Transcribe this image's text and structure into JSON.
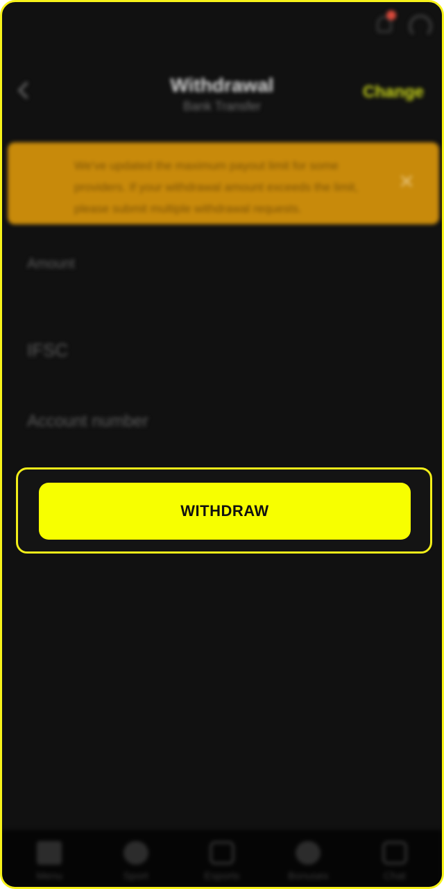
{
  "header": {
    "title": "Withdrawal",
    "subtitle": "Bank Transfer",
    "change_label": "Change"
  },
  "notice": {
    "text": "We've updated the maximum payout limit for some providers. If your withdrawal amount exceeds the limit, please submit multiple withdrawal requests.",
    "close_symbol": "✕"
  },
  "form": {
    "amount_label": "Amount",
    "ifsc_label": "IFSC",
    "account_label": "Account number"
  },
  "withdraw_button": {
    "label": "WITHDRAW"
  },
  "bottom_nav": {
    "items": [
      {
        "label": "Menu",
        "icon": "menu-icon"
      },
      {
        "label": "Sport",
        "icon": "sport-icon"
      },
      {
        "label": "Esports",
        "icon": "esports-icon"
      },
      {
        "label": "Bonuses",
        "icon": "bonuses-icon"
      },
      {
        "label": "Chat",
        "icon": "chat-icon"
      }
    ]
  },
  "colors": {
    "accent": "#f7ff00",
    "notice_bg": "#c88a0b",
    "badge": "#d9493b",
    "background": "#111111"
  }
}
